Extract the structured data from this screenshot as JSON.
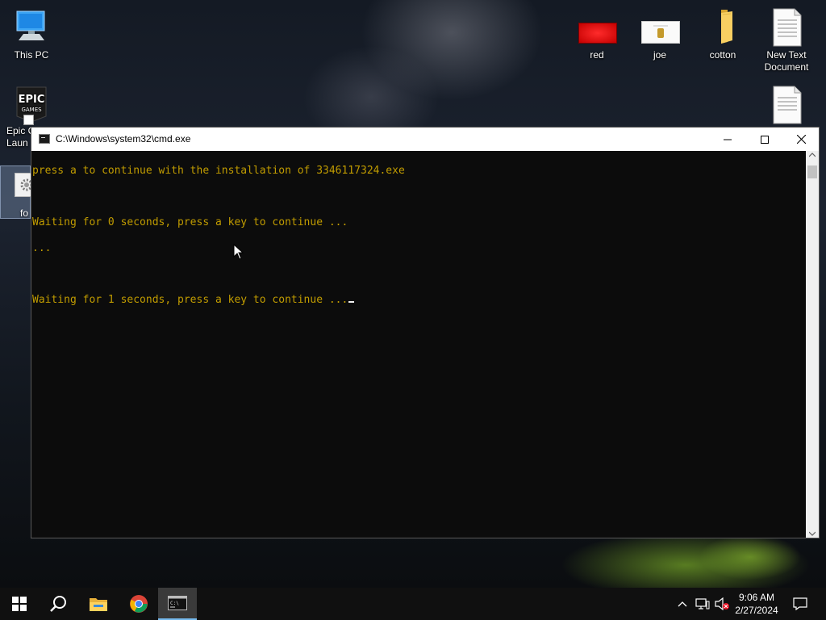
{
  "desktop": {
    "icons": [
      {
        "label": "This PC",
        "icon": "computer-icon"
      },
      {
        "label": "Epic G\nLaun",
        "icon": "epic-games-icon",
        "badge": "EPIC\nGAMES"
      },
      {
        "label": "fo",
        "icon": "settings-file-icon"
      },
      {
        "label": "red",
        "icon": "image-file-icon"
      },
      {
        "label": "joe",
        "icon": "image-file-icon"
      },
      {
        "label": "cotton",
        "icon": "folder-icon"
      },
      {
        "label": "New Text\nDocument",
        "icon": "text-document-icon"
      },
      {
        "label": "",
        "icon": "text-document-icon"
      }
    ]
  },
  "cmd_window": {
    "title": "C:\\Windows\\system32\\cmd.exe",
    "lines": [
      "press a to continue with the installation of 3346117324.exe",
      "",
      "Waiting for 0 seconds, press a key to continue ...",
      "...",
      "",
      "Waiting for 1 seconds, press a key to continue ..."
    ],
    "text_color": "#c19c00",
    "background": "#0c0c0c"
  },
  "taskbar": {
    "items": [
      "start-icon",
      "search-icon",
      "file-explorer-icon",
      "chrome-icon",
      "cmd-icon"
    ],
    "clock": {
      "time": "9:06 AM",
      "date": "2/27/2024"
    },
    "accent": "#76b9ed"
  }
}
